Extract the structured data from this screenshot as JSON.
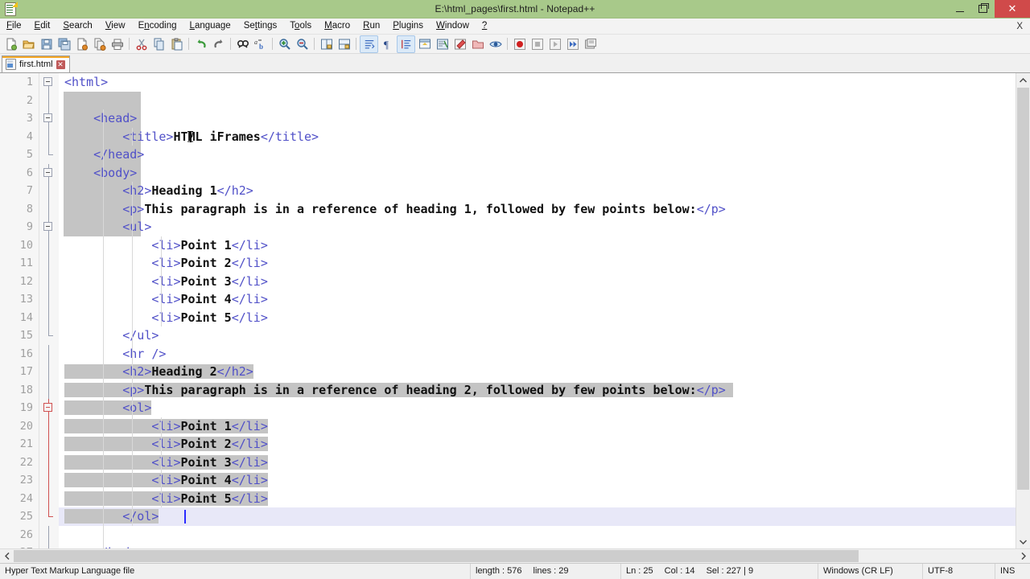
{
  "window": {
    "title": "E:\\html_pages\\first.html - Notepad++",
    "app_icon": "notepad-plus-plus-icon",
    "minimize_label": "–",
    "maximize_label": "❐",
    "close_label": "✕"
  },
  "menubar": {
    "items": [
      {
        "label": "File",
        "mnemonic": "F"
      },
      {
        "label": "Edit",
        "mnemonic": "E"
      },
      {
        "label": "Search",
        "mnemonic": "S"
      },
      {
        "label": "View",
        "mnemonic": "V"
      },
      {
        "label": "Encoding",
        "mnemonic": "n"
      },
      {
        "label": "Language",
        "mnemonic": "L"
      },
      {
        "label": "Settings",
        "mnemonic": "t"
      },
      {
        "label": "Tools",
        "mnemonic": "o"
      },
      {
        "label": "Macro",
        "mnemonic": "M"
      },
      {
        "label": "Run",
        "mnemonic": "R"
      },
      {
        "label": "Plugins",
        "mnemonic": "P"
      },
      {
        "label": "Window",
        "mnemonic": "W"
      },
      {
        "label": "?",
        "mnemonic": "?"
      }
    ],
    "document_close_label": "X"
  },
  "toolbar": {
    "buttons": [
      {
        "name": "new-file-icon",
        "tooltip": "New"
      },
      {
        "name": "open-file-icon",
        "tooltip": "Open"
      },
      {
        "name": "save-icon",
        "tooltip": "Save"
      },
      {
        "name": "save-all-icon",
        "tooltip": "Save All"
      },
      {
        "name": "close-file-icon",
        "tooltip": "Close"
      },
      {
        "name": "close-all-files-icon",
        "tooltip": "Close All"
      },
      {
        "name": "print-icon",
        "tooltip": "Print"
      },
      {
        "name": "separator",
        "tooltip": ""
      },
      {
        "name": "cut-icon",
        "tooltip": "Cut"
      },
      {
        "name": "copy-icon",
        "tooltip": "Copy"
      },
      {
        "name": "paste-icon",
        "tooltip": "Paste"
      },
      {
        "name": "separator",
        "tooltip": ""
      },
      {
        "name": "undo-icon",
        "tooltip": "Undo"
      },
      {
        "name": "redo-icon",
        "tooltip": "Redo"
      },
      {
        "name": "separator",
        "tooltip": ""
      },
      {
        "name": "find-icon",
        "tooltip": "Find"
      },
      {
        "name": "replace-icon",
        "tooltip": "Replace"
      },
      {
        "name": "separator",
        "tooltip": ""
      },
      {
        "name": "zoom-in-icon",
        "tooltip": "Zoom In"
      },
      {
        "name": "zoom-out-icon",
        "tooltip": "Zoom Out"
      },
      {
        "name": "separator",
        "tooltip": ""
      },
      {
        "name": "sync-vertical-scroll-icon",
        "tooltip": "Synchronize Vertical Scrolling"
      },
      {
        "name": "sync-horizontal-scroll-icon",
        "tooltip": "Synchronize Horizontal Scrolling"
      },
      {
        "name": "separator",
        "tooltip": ""
      },
      {
        "name": "word-wrap-icon",
        "tooltip": "Word wrap"
      },
      {
        "name": "show-all-characters-icon",
        "tooltip": "Show All Characters"
      },
      {
        "name": "indent-guide-icon",
        "tooltip": "Show Indent Guide"
      },
      {
        "name": "user-defined-dialog-icon",
        "tooltip": "User-Defined Dialogue"
      },
      {
        "name": "document-map-icon",
        "tooltip": "Document Map"
      },
      {
        "name": "function-list-icon",
        "tooltip": "Function List"
      },
      {
        "name": "folder-as-workspace-icon",
        "tooltip": "Folder as Workspace"
      },
      {
        "name": "monitoring-icon",
        "tooltip": "Monitoring"
      },
      {
        "name": "separator",
        "tooltip": ""
      },
      {
        "name": "macro-record-icon",
        "tooltip": "Start Recording"
      },
      {
        "name": "macro-stop-icon",
        "tooltip": "Stop Recording"
      },
      {
        "name": "macro-play-icon",
        "tooltip": "Playback"
      },
      {
        "name": "macro-run-multiple-icon",
        "tooltip": "Run a Macro Multiple Times"
      },
      {
        "name": "macro-save-icon",
        "tooltip": "Save Currently Recorded Macro"
      }
    ]
  },
  "tabs": [
    {
      "label": "first.html",
      "icon": "html-file-icon",
      "close_label": "✕",
      "active": true
    }
  ],
  "editor": {
    "caret_line": 25,
    "lines": [
      {
        "n": 1,
        "fold": "open",
        "tokens": [
          {
            "t": "tag",
            "v": "<html>"
          }
        ]
      },
      {
        "n": 2,
        "fold": "line",
        "tokens": []
      },
      {
        "n": 3,
        "fold": "open",
        "tokens": [
          {
            "t": "tag",
            "v": "    <head>"
          }
        ]
      },
      {
        "n": 4,
        "fold": "line",
        "tokens": [
          {
            "t": "tag",
            "v": "        <title>"
          },
          {
            "t": "txt",
            "v": "HTML iFrames"
          },
          {
            "t": "tag",
            "v": "</title>"
          }
        ]
      },
      {
        "n": 5,
        "fold": "end",
        "tokens": [
          {
            "t": "tag",
            "v": "    </head>"
          }
        ]
      },
      {
        "n": 6,
        "fold": "open",
        "tokens": [
          {
            "t": "tag",
            "v": "    <body>"
          }
        ]
      },
      {
        "n": 7,
        "fold": "line",
        "tokens": [
          {
            "t": "tag",
            "v": "        <h2>"
          },
          {
            "t": "txt",
            "v": "Heading 1"
          },
          {
            "t": "tag",
            "v": "</h2>"
          }
        ]
      },
      {
        "n": 8,
        "fold": "line",
        "tokens": [
          {
            "t": "tag",
            "v": "        <p>"
          },
          {
            "t": "txt",
            "v": "This paragraph is in a reference of heading 1, followed by few points below:"
          },
          {
            "t": "tag",
            "v": "</p>"
          }
        ]
      },
      {
        "n": 9,
        "fold": "open",
        "tokens": [
          {
            "t": "tag",
            "v": "        <ul>"
          }
        ]
      },
      {
        "n": 10,
        "fold": "line",
        "tokens": [
          {
            "t": "tag",
            "v": "            <li>"
          },
          {
            "t": "txt",
            "v": "Point 1"
          },
          {
            "t": "tag",
            "v": "</li>"
          }
        ]
      },
      {
        "n": 11,
        "fold": "line",
        "tokens": [
          {
            "t": "tag",
            "v": "            <li>"
          },
          {
            "t": "txt",
            "v": "Point 2"
          },
          {
            "t": "tag",
            "v": "</li>"
          }
        ]
      },
      {
        "n": 12,
        "fold": "line",
        "tokens": [
          {
            "t": "tag",
            "v": "            <li>"
          },
          {
            "t": "txt",
            "v": "Point 3"
          },
          {
            "t": "tag",
            "v": "</li>"
          }
        ]
      },
      {
        "n": 13,
        "fold": "line",
        "tokens": [
          {
            "t": "tag",
            "v": "            <li>"
          },
          {
            "t": "txt",
            "v": "Point 4"
          },
          {
            "t": "tag",
            "v": "</li>"
          }
        ]
      },
      {
        "n": 14,
        "fold": "line",
        "tokens": [
          {
            "t": "tag",
            "v": "            <li>"
          },
          {
            "t": "txt",
            "v": "Point 5"
          },
          {
            "t": "tag",
            "v": "</li>"
          }
        ]
      },
      {
        "n": 15,
        "fold": "end",
        "tokens": [
          {
            "t": "tag",
            "v": "        </ul>"
          }
        ]
      },
      {
        "n": 16,
        "fold": "line",
        "tokens": [
          {
            "t": "tag",
            "v": "        <hr />"
          }
        ]
      },
      {
        "n": 17,
        "fold": "line",
        "tokens": [
          {
            "t": "tag",
            "v": "        <h2>"
          },
          {
            "t": "txt",
            "v": "Heading 2"
          },
          {
            "t": "tag",
            "v": "</h2>"
          }
        ]
      },
      {
        "n": 18,
        "fold": "line",
        "tokens": [
          {
            "t": "tag",
            "v": "        <p>"
          },
          {
            "t": "txt",
            "v": "This paragraph is in a reference of heading 2, followed by few points below:"
          },
          {
            "t": "tag",
            "v": "</p>"
          }
        ]
      },
      {
        "n": 19,
        "fold": "openred",
        "tokens": [
          {
            "t": "tag",
            "v": "        <ol>"
          }
        ]
      },
      {
        "n": 20,
        "fold": "red",
        "tokens": [
          {
            "t": "tag",
            "v": "            <li>"
          },
          {
            "t": "txt",
            "v": "Point 1"
          },
          {
            "t": "tag",
            "v": "</li>"
          }
        ]
      },
      {
        "n": 21,
        "fold": "red",
        "tokens": [
          {
            "t": "tag",
            "v": "            <li>"
          },
          {
            "t": "txt",
            "v": "Point 2"
          },
          {
            "t": "tag",
            "v": "</li>"
          }
        ]
      },
      {
        "n": 22,
        "fold": "red",
        "tokens": [
          {
            "t": "tag",
            "v": "            <li>"
          },
          {
            "t": "txt",
            "v": "Point 3"
          },
          {
            "t": "tag",
            "v": "</li>"
          }
        ]
      },
      {
        "n": 23,
        "fold": "red",
        "tokens": [
          {
            "t": "tag",
            "v": "            <li>"
          },
          {
            "t": "txt",
            "v": "Point 4"
          },
          {
            "t": "tag",
            "v": "</li>"
          }
        ]
      },
      {
        "n": 24,
        "fold": "red",
        "tokens": [
          {
            "t": "tag",
            "v": "            <li>"
          },
          {
            "t": "txt",
            "v": "Point 5"
          },
          {
            "t": "tag",
            "v": "</li>"
          }
        ]
      },
      {
        "n": 25,
        "fold": "redend",
        "tokens": [
          {
            "t": "tag",
            "v": "        </ol>"
          }
        ]
      },
      {
        "n": 26,
        "fold": "line",
        "tokens": []
      },
      {
        "n": 27,
        "fold": "end",
        "tokens": [
          {
            "t": "tag",
            "v": "    </body>"
          }
        ]
      }
    ]
  },
  "statusbar": {
    "file_type": "Hyper Text Markup Language file",
    "length_label": "length : 576",
    "lines_label": "lines : 29",
    "ln_label": "Ln : 25",
    "col_label": "Col : 14",
    "sel_label": "Sel : 227 | 9",
    "eol": "Windows (CR LF)",
    "encoding": "UTF-8",
    "insert_mode": "INS"
  },
  "scrollbars": {
    "vertical_up": "▲",
    "vertical_down": "▼",
    "horizontal_left": "◄",
    "horizontal_right": "►"
  }
}
